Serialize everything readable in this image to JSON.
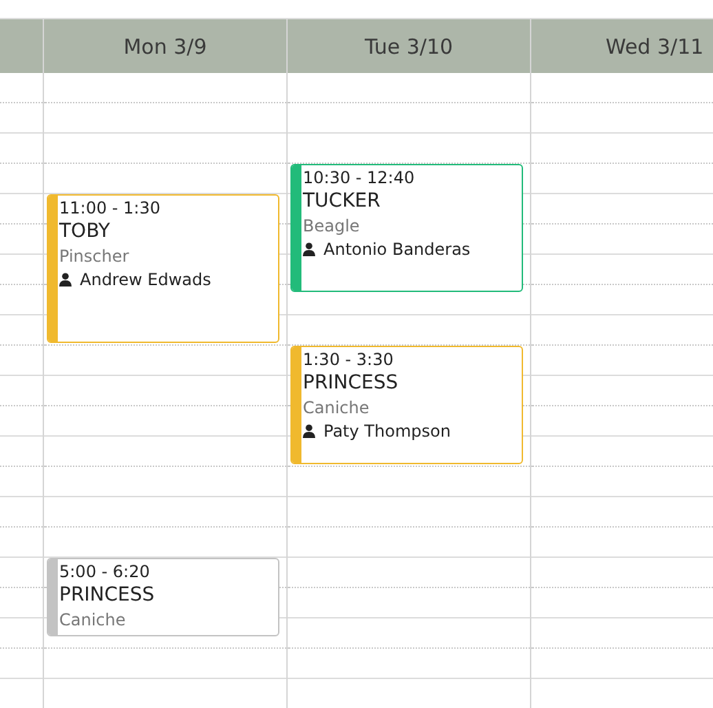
{
  "days": [
    {
      "label": "Mon 3/9",
      "events": [
        {
          "time": "11:00 - 1:30",
          "pet": "TOBY",
          "breed": "Pinscher",
          "owner": "Andrew Edwads",
          "color": "#f0b92e"
        },
        {
          "time": "5:00 - 6:20",
          "pet": "PRINCESS",
          "breed": "Caniche",
          "color": "#c3c3c3"
        }
      ]
    },
    {
      "label": "Tue 3/10",
      "events": [
        {
          "time": "10:30 - 12:40",
          "pet": "TUCKER",
          "breed": "Beagle",
          "owner": "Antonio Banderas",
          "color": "#22bb7a"
        },
        {
          "time": "1:30 - 3:30",
          "pet": "PRINCESS",
          "breed": "Caniche",
          "owner": "Paty Thompson",
          "color": "#f0b92e"
        }
      ]
    },
    {
      "label": "Wed 3/11"
    }
  ]
}
